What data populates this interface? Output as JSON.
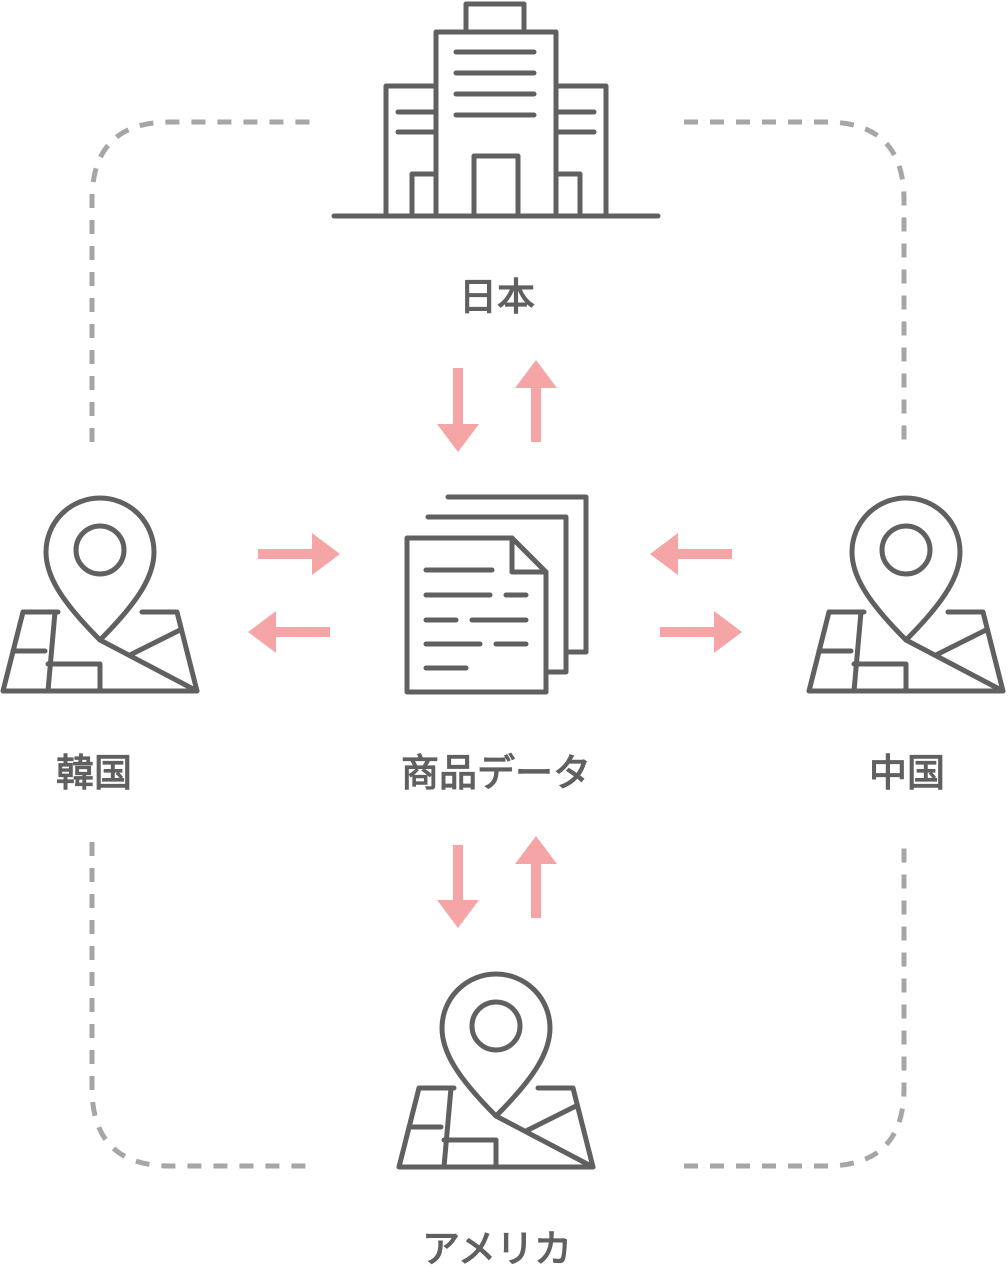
{
  "nodes": {
    "japan": "日本",
    "korea": "韓国",
    "product_data": "商品データ",
    "china": "中国",
    "america": "アメリカ"
  },
  "colors": {
    "icon": "#606060",
    "arrow": "#f5a5a5",
    "dashed_loop": "#a6a6a6"
  },
  "icons": {
    "japan": "office-building-icon",
    "korea": "map-pin-icon",
    "china": "map-pin-icon",
    "america": "map-pin-icon",
    "product_data": "documents-stack-icon"
  }
}
